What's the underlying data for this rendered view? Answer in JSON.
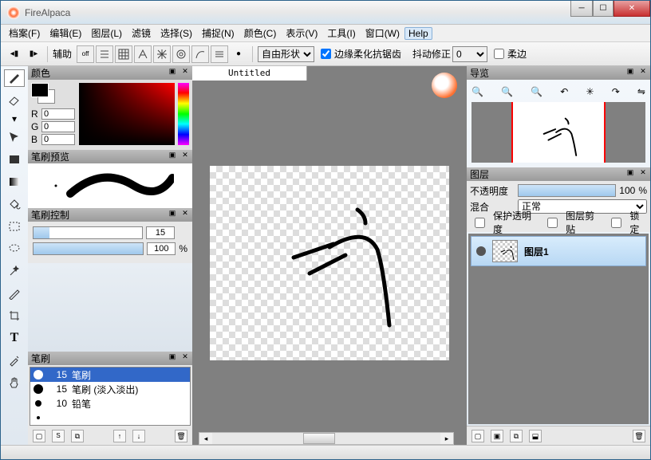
{
  "window": {
    "title": "FireAlpaca"
  },
  "menu": {
    "file": "档案(F)",
    "edit": "编辑(E)",
    "layer": "图层(L)",
    "filter": "滤镜",
    "select": "选择(S)",
    "snap": "捕捉(N)",
    "color": "颜色(C)",
    "view": "表示(V)",
    "tool": "工具(I)",
    "window": "窗口(W)",
    "help": "Help"
  },
  "toolbar": {
    "aux_label": "辅助",
    "shape_label": "自由形状",
    "aa_label": "边缘柔化抗锯齿",
    "jitter_label": "抖动修正",
    "jitter_value": "0",
    "soft_label": "柔边"
  },
  "panels": {
    "color": {
      "title": "颜色",
      "r_label": "R",
      "g_label": "G",
      "b_label": "B",
      "r": "0",
      "g": "0",
      "b": "0"
    },
    "brush_preview": {
      "title": "笔刷预览"
    },
    "brush_ctrl": {
      "title": "笔刷控制",
      "size_value": "15",
      "size_pct": 15,
      "opacity_value": "100",
      "opacity_unit": "%",
      "opacity_pct": 100
    },
    "brush_list": {
      "title": "笔刷",
      "items": [
        {
          "size": "15",
          "name": "笔刷",
          "selected": true,
          "dot": 12
        },
        {
          "size": "15",
          "name": "笔刷 (淡入淡出)",
          "selected": false,
          "dot": 12
        },
        {
          "size": "10",
          "name": "铅笔",
          "selected": false,
          "dot": 8
        }
      ]
    },
    "navigator": {
      "title": "导览"
    },
    "layers": {
      "title": "图层",
      "opacity_label": "不透明度",
      "opacity_value": "100",
      "opacity_unit": "%",
      "blend_label": "混合",
      "blend_value": "正常",
      "protect_label": "保护透明度",
      "clip_label": "图层剪贴",
      "lock_label": "锁定",
      "items": [
        {
          "name": "图层1"
        }
      ]
    }
  },
  "document": {
    "tab": "Untitled"
  }
}
